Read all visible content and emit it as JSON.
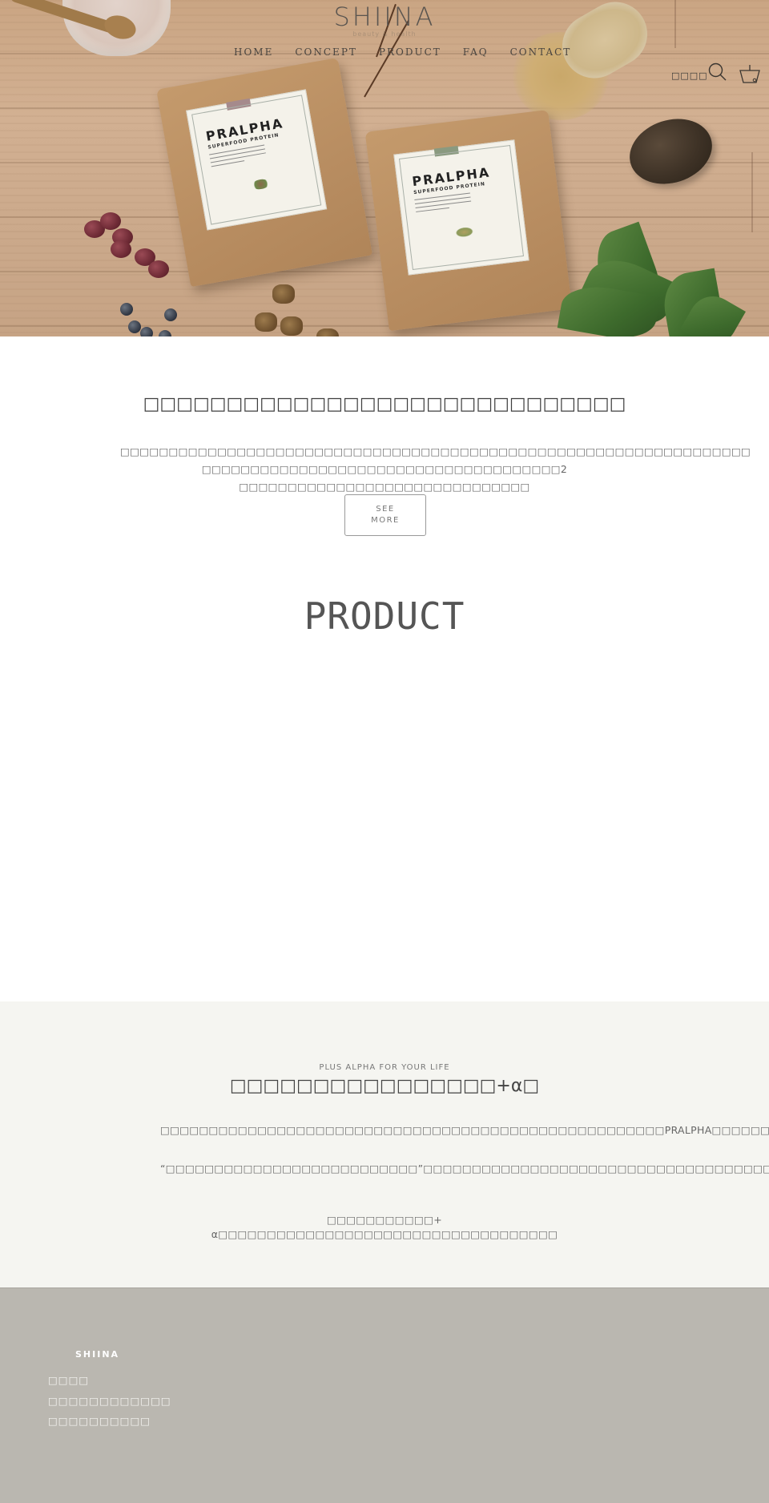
{
  "header": {
    "logo": "SHIINA",
    "logo_tagline": "beauty & health",
    "nav": [
      {
        "label": "HOME"
      },
      {
        "label": "CONCEPT"
      },
      {
        "label": "PRODUCT"
      },
      {
        "label": "FAQ"
      },
      {
        "label": "CONTACT"
      }
    ],
    "account_label": "□□□□",
    "icons": {
      "search": "search-icon",
      "cart": "cart-icon"
    }
  },
  "hero": {
    "pouch_brand": "PRALPHA",
    "pouch_subtitle": "SUPERFOOD PROTEIN",
    "pouch_tab_colors": [
      "#a58a8c",
      "#8a9a80"
    ]
  },
  "intro": {
    "title": "□□□□□□□□□□□□□□□□□□□□□□□□□□□□□",
    "paragraph_line1": "□□□□□□□□□□□□□□□□□□□□□□□□□□□□□□□□□□□□□□□□□□□□□□□□□□□□□□□□□□□□□□□□□",
    "paragraph_line2": "□□□□□□□□□□□□□□□□□□□□□□□□□□□□□□□□□□□□□2 □□□□□□□□□□□□□□□□□□□□□□□□□□□□□□",
    "see_more_label": "SEE MORE"
  },
  "product": {
    "heading": "PRODUCT"
  },
  "plus_alpha": {
    "kicker": "PLUS ALPHA FOR YOUR LIFE",
    "title": "□□□□□□□□□□□□□□□□+α□",
    "paragraph1": "□□□□□□□□□□□□□□□□□□□□□□□□□□□□□□□□□□□□□□□□□□□□□□□□□□□□PRALPHA□□□□□□□□□□□□□□□□",
    "paragraph2": "“□□□□□□□□□□□□□□□□□□□□□□□□□□”□□□□□□□□□□□□□□□□□□□□□□□□□□□□□□□□□□□□□□□□□□□□□□□□□□",
    "paragraph3": "□□□□□□□□□□□+ α□□□□□□□□□□□□□□□□□□□□□□□□□□□□□□□□□□□"
  },
  "footer": {
    "logo": "SHIINA",
    "links": [
      {
        "label": "□□□□"
      },
      {
        "label": "□□□□□□□□□□□□"
      },
      {
        "label": "□□□□□□□□□□"
      }
    ]
  },
  "colors": {
    "section_beige": "#f5f5f1",
    "footer_gray": "#bab7b0",
    "text_dark": "#444444"
  }
}
